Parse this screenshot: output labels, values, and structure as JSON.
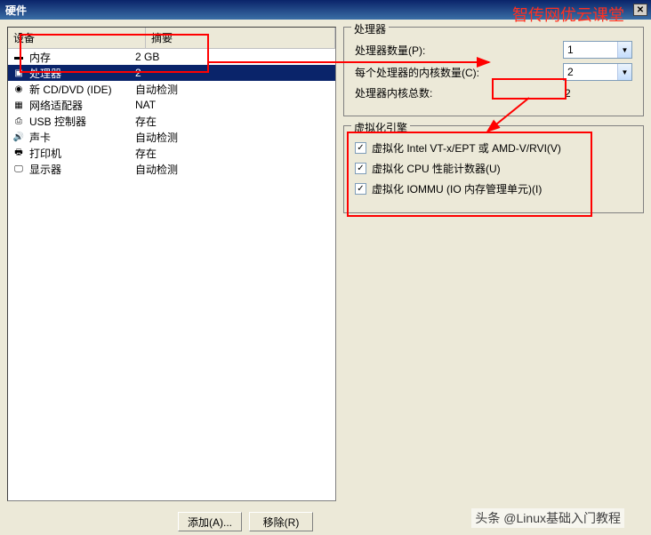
{
  "window": {
    "title": "硬件"
  },
  "watermark_top": "智传网优云课堂",
  "watermark_bottom": "头条 @Linux基础入门教程",
  "list": {
    "header_device": "设备",
    "header_summary": "摘要",
    "rows": [
      {
        "icon": "memory-icon",
        "device": "内存",
        "summary": "2 GB",
        "selected": false
      },
      {
        "icon": "cpu-icon",
        "device": "处理器",
        "summary": "2",
        "selected": true
      },
      {
        "icon": "disc-icon",
        "device": "新 CD/DVD (IDE)",
        "summary": "自动检测",
        "selected": false
      },
      {
        "icon": "network-icon",
        "device": "网络适配器",
        "summary": "NAT",
        "selected": false
      },
      {
        "icon": "usb-icon",
        "device": "USB 控制器",
        "summary": "存在",
        "selected": false
      },
      {
        "icon": "sound-icon",
        "device": "声卡",
        "summary": "自动检测",
        "selected": false
      },
      {
        "icon": "printer-icon",
        "device": "打印机",
        "summary": "存在",
        "selected": false
      },
      {
        "icon": "display-icon",
        "device": "显示器",
        "summary": "自动检测",
        "selected": false
      }
    ]
  },
  "processor": {
    "legend": "处理器",
    "cpu_count_label": "处理器数量(P):",
    "cpu_count_value": "1",
    "cores_label": "每个处理器的内核数量(C):",
    "cores_value": "2",
    "total_label": "处理器内核总数:",
    "total_value": "2"
  },
  "virt": {
    "legend": "虚拟化引擎",
    "opt1": "虚拟化 Intel VT-x/EPT 或 AMD-V/RVI(V)",
    "opt2": "虚拟化 CPU 性能计数器(U)",
    "opt3": "虚拟化 IOMMU (IO 内存管理单元)(I)",
    "opt1_checked": true,
    "opt2_checked": true,
    "opt3_checked": true
  },
  "buttons": {
    "add": "添加(A)...",
    "remove": "移除(R)"
  }
}
